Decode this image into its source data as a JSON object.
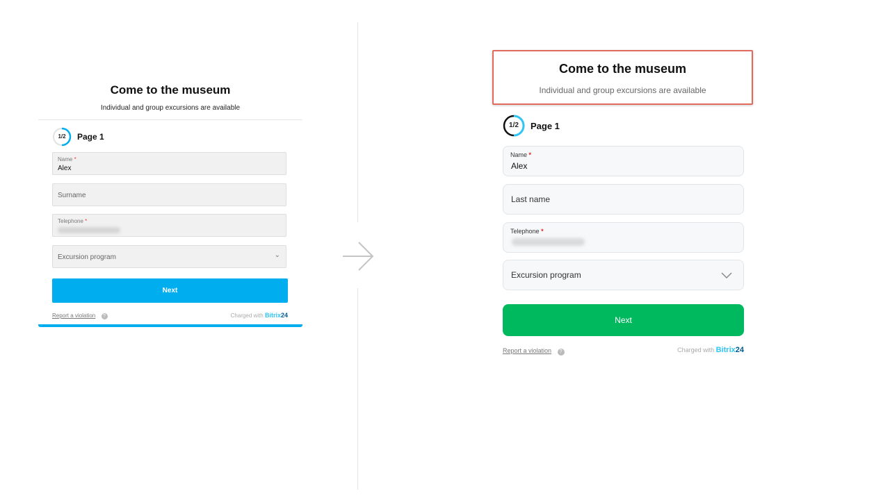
{
  "old_form": {
    "title": "Come to the museum",
    "subtitle": "Individual and group excursions are available",
    "step_badge": "1/2",
    "step_label": "Page 1",
    "name_label": "Name",
    "required_mark": "*",
    "name_value": "Alex",
    "surname_placeholder": "Surname",
    "telephone_label": "Telephone",
    "excursion_placeholder": "Excursion program",
    "next_label": "Next",
    "report_label": "Report a violation",
    "help_icon": "?",
    "charged_label": "Charged with",
    "brand_name": "Bitrix",
    "brand_number": "24",
    "accent_color": "#00aeef"
  },
  "new_form": {
    "title": "Come to the museum",
    "subtitle": "Individual and group excursions are available",
    "step_badge": "1/2",
    "step_label": "Page 1",
    "name_label": "Name",
    "required_mark": "*",
    "name_value": "Alex",
    "lastname_placeholder": "Last name",
    "telephone_label": "Telephone",
    "excursion_placeholder": "Excursion program",
    "next_label": "Next",
    "report_label": "Report a violation",
    "help_icon": "?",
    "charged_label": "Charged with",
    "brand_name": "Bitrix",
    "brand_number": "24",
    "accent_color": "#00b95f",
    "highlight_color": "#e06a5b"
  }
}
